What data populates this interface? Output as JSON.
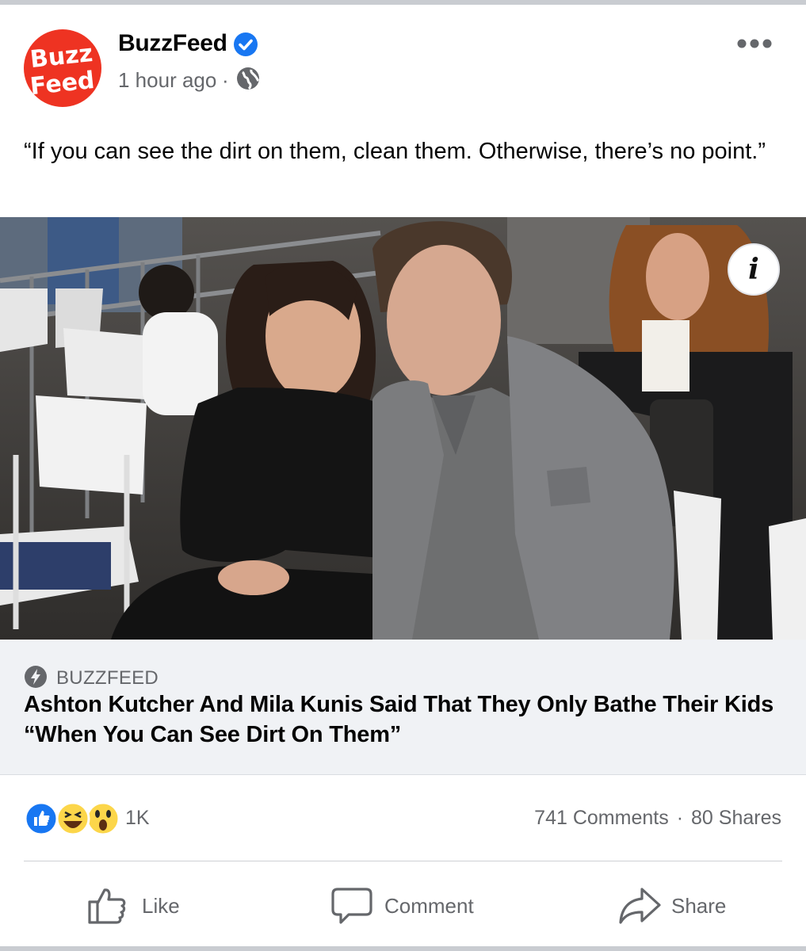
{
  "post": {
    "page_name": "BuzzFeed",
    "avatar_line1": "Buzz",
    "avatar_line2": "Feed",
    "time": "1 hour ago",
    "dot": "·",
    "caption": "“If you can see the dirt on them, clean them. Otherwise, there’s no point.”"
  },
  "link": {
    "source": "BUZZFEED",
    "title": "Ashton Kutcher And Mila Kunis Said That They Only Bathe Their Kids “When You Can See Dirt On Them”"
  },
  "engagement": {
    "reaction_count": "1K",
    "comments": "741 Comments",
    "separator": "·",
    "shares": "80 Shares",
    "reaction_icons": [
      "like-reaction-icon",
      "haha-reaction-icon",
      "wow-reaction-icon"
    ]
  },
  "actions": {
    "like": "Like",
    "comment": "Comment",
    "share": "Share"
  },
  "icons": [
    "verified-badge-icon",
    "globe-icon",
    "more-options-icon",
    "info-icon",
    "bolt-icon",
    "thumbs-up-icon",
    "comment-icon",
    "share-icon"
  ],
  "colors": {
    "brand_red": "#ee3322",
    "verified_blue": "#1877f2",
    "secondary_text": "#65676b",
    "link_bg": "#f0f2f5"
  }
}
